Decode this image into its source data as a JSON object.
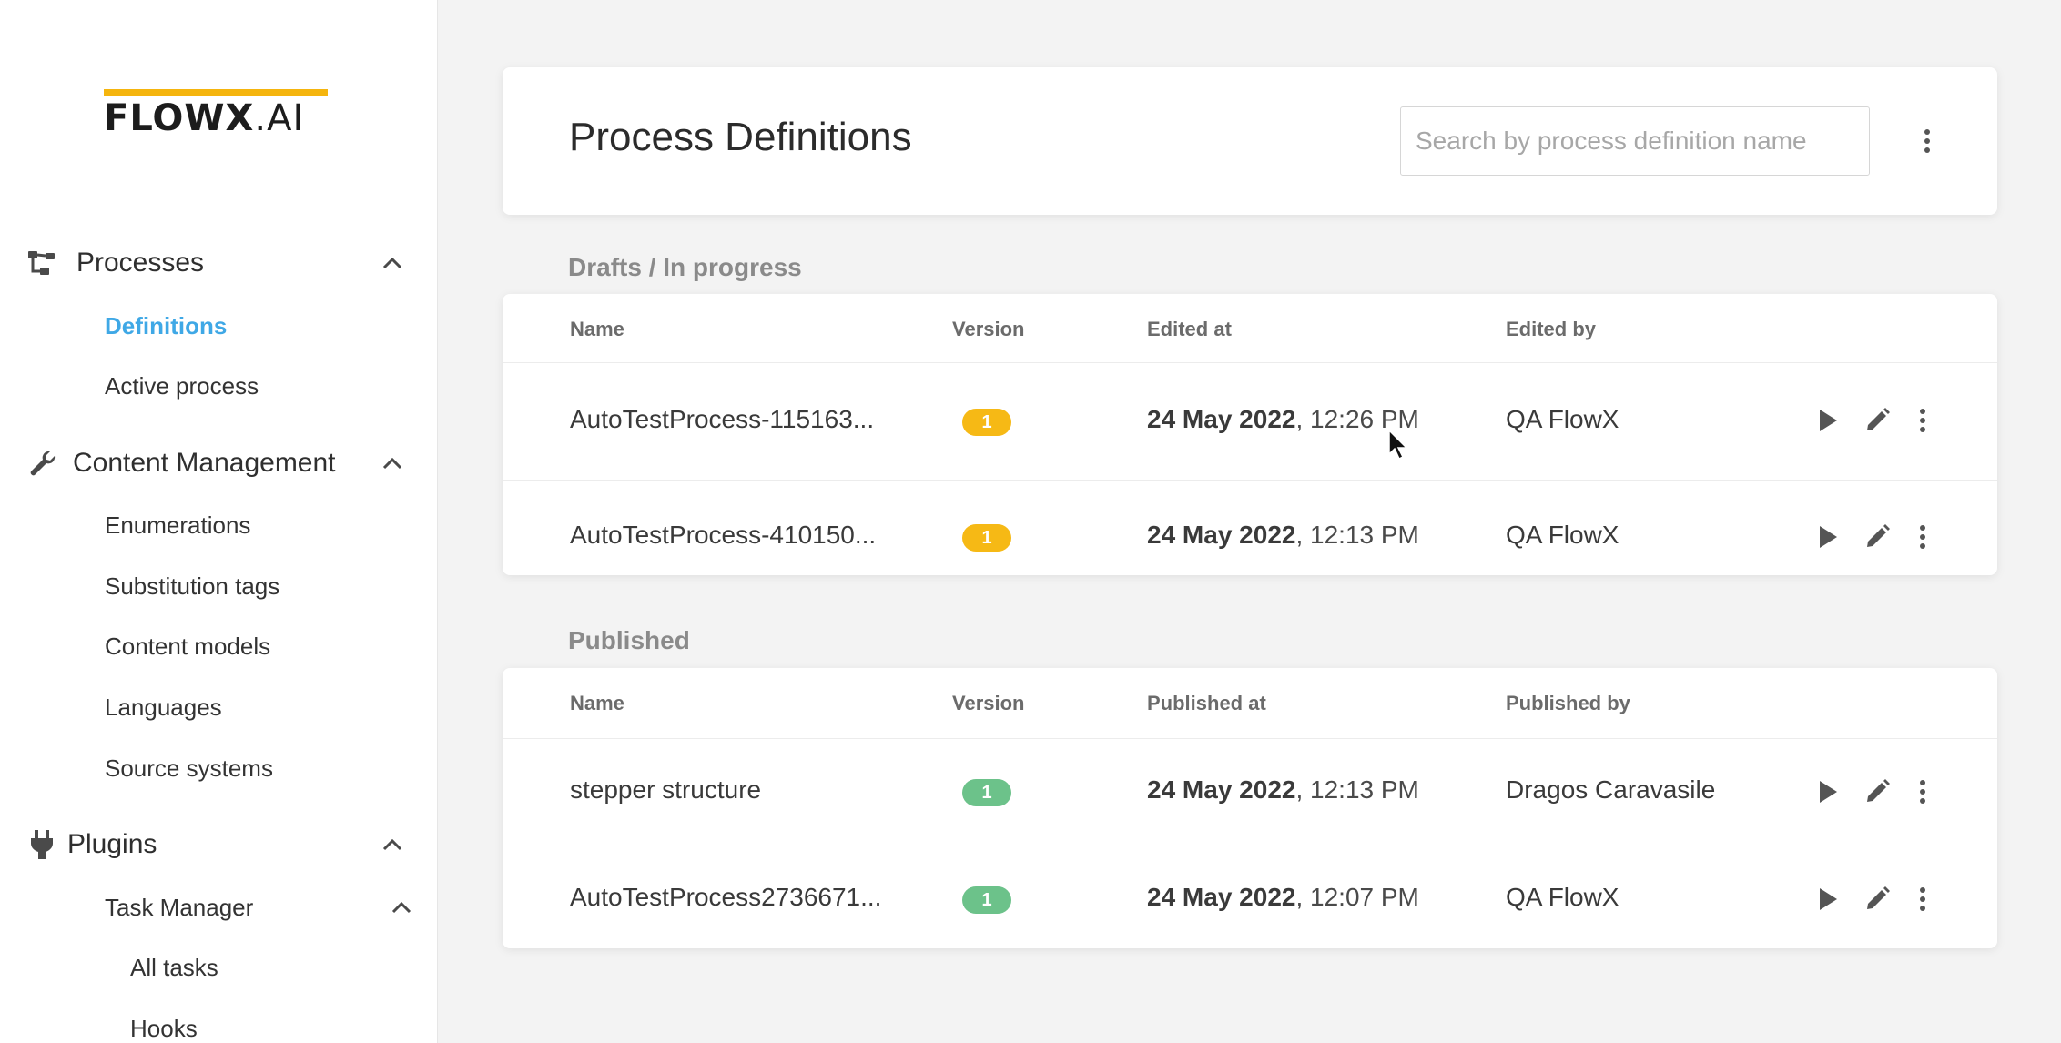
{
  "brand": {
    "logo_bold": "FLOWX",
    "logo_light": ".AI",
    "accent": "#f5b50e"
  },
  "sidebar": {
    "groups": [
      {
        "label": "Processes",
        "icon": "flow-icon",
        "items": [
          {
            "label": "Definitions",
            "active": true
          },
          {
            "label": "Active process",
            "active": false
          }
        ]
      },
      {
        "label": "Content Management",
        "icon": "wrench-icon",
        "items": [
          {
            "label": "Enumerations"
          },
          {
            "label": "Substitution tags"
          },
          {
            "label": "Content models"
          },
          {
            "label": "Languages"
          },
          {
            "label": "Source systems"
          }
        ]
      },
      {
        "label": "Plugins",
        "icon": "plug-icon",
        "items": [
          {
            "label": "Task Manager"
          }
        ],
        "subitems": [
          {
            "label": "All tasks"
          },
          {
            "label": "Hooks"
          }
        ]
      }
    ],
    "active_color": "#3fa8e6"
  },
  "header": {
    "title": "Process Definitions",
    "search_placeholder": "Search by process definition name"
  },
  "drafts": {
    "section_title": "Drafts / In progress",
    "columns": [
      "Name",
      "Version",
      "Edited at",
      "Edited by"
    ],
    "rows": [
      {
        "name": "AutoTestProcess-115163...",
        "version": "1",
        "date": "24 May 2022",
        "time": ", 12:26 PM",
        "user": "QA FlowX"
      },
      {
        "name": "AutoTestProcess-410150...",
        "version": "1",
        "date": "24 May 2022",
        "time": ", 12:13 PM",
        "user": "QA FlowX"
      }
    ],
    "badge_color": "#f6b915"
  },
  "published": {
    "section_title": "Published",
    "columns": [
      "Name",
      "Version",
      "Published at",
      "Published by"
    ],
    "rows": [
      {
        "name": "stepper structure",
        "version": "1",
        "date": "24 May 2022",
        "time": ", 12:13 PM",
        "user": "Dragos Caravasile"
      },
      {
        "name": "AutoTestProcess2736671...",
        "version": "1",
        "date": "24 May 2022",
        "time": ", 12:07 PM",
        "user": "QA FlowX"
      }
    ],
    "badge_color": "#6cc28a"
  }
}
